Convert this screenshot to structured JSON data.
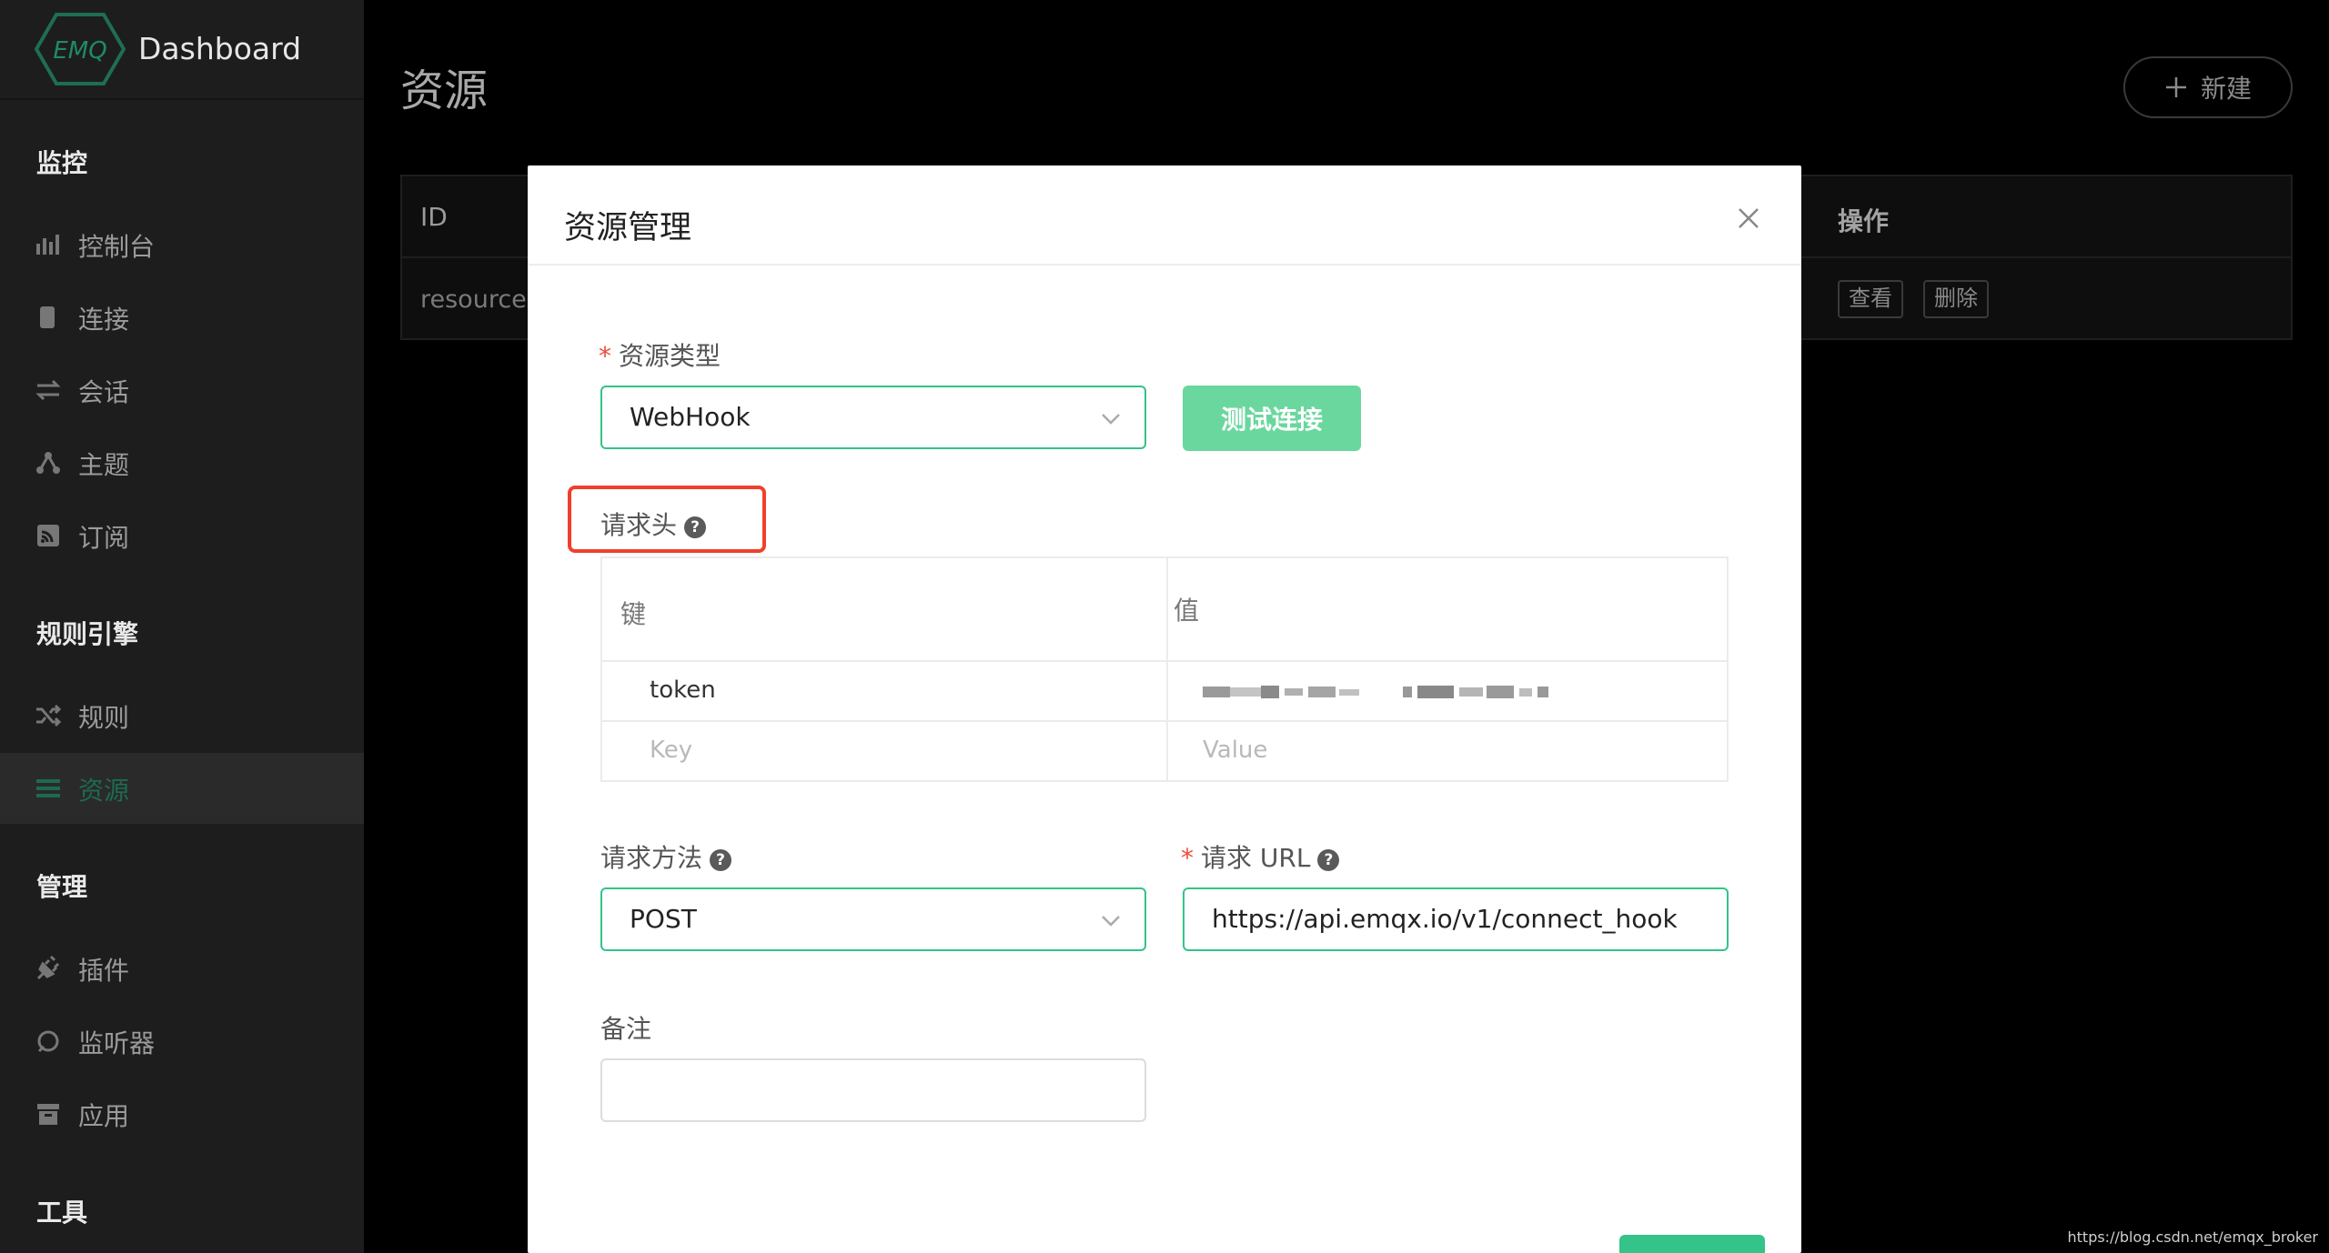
{
  "app": {
    "logo_text": "EMQ",
    "brand": "Dashboard"
  },
  "sidebar": {
    "groups": [
      {
        "title": "监控",
        "items": [
          {
            "label": "控制台",
            "icon": "bar-chart-icon"
          },
          {
            "label": "连接",
            "icon": "device-icon"
          },
          {
            "label": "会话",
            "icon": "arrows-icon"
          },
          {
            "label": "主题",
            "icon": "topic-nodes-icon"
          },
          {
            "label": "订阅",
            "icon": "rss-icon"
          }
        ]
      },
      {
        "title": "规则引擎",
        "items": [
          {
            "label": "规则",
            "icon": "shuffle-icon"
          },
          {
            "label": "资源",
            "icon": "list-icon",
            "active": true
          }
        ]
      },
      {
        "title": "管理",
        "items": [
          {
            "label": "插件",
            "icon": "plug-icon"
          },
          {
            "label": "监听器",
            "icon": "ring-icon"
          },
          {
            "label": "应用",
            "icon": "box-icon"
          }
        ]
      },
      {
        "title": "工具",
        "items": []
      }
    ]
  },
  "page": {
    "title": "资源",
    "new_button": "新建",
    "table": {
      "col_id": "ID",
      "col_actions": "操作",
      "row_id": "resource:",
      "view_button": "查看",
      "delete_button": "删除"
    }
  },
  "modal": {
    "title": "资源管理",
    "resource_type_label": "资源类型",
    "resource_type_value": "WebHook",
    "test_button": "测试连接",
    "headers_label": "请求头",
    "headers_table": {
      "key_col": "键",
      "value_col": "值",
      "rows": [
        {
          "key": "token",
          "value": ""
        }
      ],
      "key_placeholder": "Key",
      "value_placeholder": "Value"
    },
    "method_label": "请求方法",
    "method_value": "POST",
    "url_label": "请求 URL",
    "url_value": "https://api.emqx.io/v1/connect_hook",
    "remark_label": "备注",
    "remark_value": ""
  },
  "colors": {
    "accent": "#34c388",
    "test_button": "#6ad79e",
    "highlight": "#f0402b",
    "required": "#f04b3a"
  },
  "watermark": "https://blog.csdn.net/emqx_broker"
}
